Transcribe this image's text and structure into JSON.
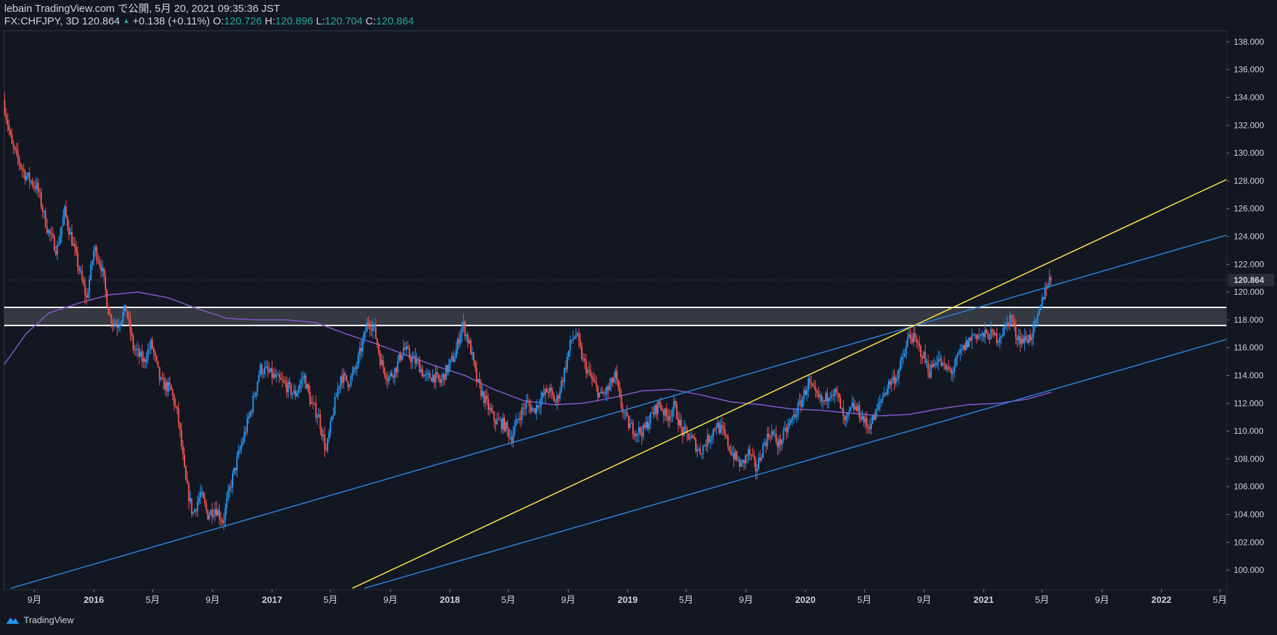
{
  "header": {
    "publish_line": "lebain TradingView.com で公開, 5月 20, 2021 09:35:36 JST",
    "symbol": "FX:CHFJPY, 3D",
    "last": "120.864",
    "change_arrow": "▲",
    "change": "+0.138 (+0.11%)",
    "o_label": "O:",
    "o_value": "120.726",
    "h_label": "H:",
    "h_value": "120.896",
    "l_label": "L:",
    "l_value": "120.704",
    "c_label": "C:",
    "c_value": "120.864"
  },
  "footer": {
    "brand": "TradingView",
    "logo_icon": "tradingview-logo-icon"
  },
  "colors": {
    "background": "#131722",
    "up": "#2196f3",
    "down": "#ef5350",
    "trendline_blue": "#2a7fd4",
    "trendline_yellow": "#f5e243",
    "ma": "#7e57c2",
    "zone_fill": "#3a3d45",
    "zone_border": "#ffffff",
    "price_label_bg": "#2a2e39"
  },
  "chart_data": {
    "type": "candlestick",
    "symbol": "FX:CHFJPY",
    "interval": "3D",
    "ylim": [
      98.6,
      138.8
    ],
    "xlim": [
      "2015-07-01",
      "2022-05-15"
    ],
    "y_ticks": [
      "100.000",
      "102.000",
      "104.000",
      "106.000",
      "108.000",
      "110.000",
      "112.000",
      "114.000",
      "116.000",
      "118.000",
      "120.000",
      "122.000",
      "124.000",
      "126.000",
      "128.000",
      "130.000",
      "132.000",
      "134.000",
      "136.000",
      "138.000"
    ],
    "x_ticks": [
      {
        "label": "9月",
        "date": "2015-09-01",
        "bold": false
      },
      {
        "label": "2016",
        "date": "2016-01-01",
        "bold": true
      },
      {
        "label": "5月",
        "date": "2016-05-01",
        "bold": false
      },
      {
        "label": "9月",
        "date": "2016-09-01",
        "bold": false
      },
      {
        "label": "2017",
        "date": "2017-01-01",
        "bold": true
      },
      {
        "label": "5月",
        "date": "2017-05-01",
        "bold": false
      },
      {
        "label": "9月",
        "date": "2017-09-01",
        "bold": false
      },
      {
        "label": "2018",
        "date": "2018-01-01",
        "bold": true
      },
      {
        "label": "5月",
        "date": "2018-05-01",
        "bold": false
      },
      {
        "label": "9月",
        "date": "2018-09-01",
        "bold": false
      },
      {
        "label": "2019",
        "date": "2019-01-01",
        "bold": true
      },
      {
        "label": "5月",
        "date": "2019-05-01",
        "bold": false
      },
      {
        "label": "9月",
        "date": "2019-09-01",
        "bold": false
      },
      {
        "label": "2020",
        "date": "2020-01-01",
        "bold": true
      },
      {
        "label": "5月",
        "date": "2020-05-01",
        "bold": false
      },
      {
        "label": "9月",
        "date": "2020-09-01",
        "bold": false
      },
      {
        "label": "2021",
        "date": "2021-01-01",
        "bold": true
      },
      {
        "label": "5月",
        "date": "2021-05-01",
        "bold": false
      },
      {
        "label": "9月",
        "date": "2021-09-01",
        "bold": false
      },
      {
        "label": "2022",
        "date": "2022-01-01",
        "bold": true
      },
      {
        "label": "5月",
        "date": "2022-05-01",
        "bold": false
      }
    ],
    "last_price": "120.864",
    "price_path": [
      [
        "2015-07-02",
        133.8
      ],
      [
        "2015-07-20",
        130.5
      ],
      [
        "2015-08-15",
        128.5
      ],
      [
        "2015-09-10",
        127.5
      ],
      [
        "2015-10-01",
        124.5
      ],
      [
        "2015-10-20",
        123.0
      ],
      [
        "2015-11-05",
        125.8
      ],
      [
        "2015-11-25",
        123.0
      ],
      [
        "2015-12-20",
        119.5
      ],
      [
        "2016-01-05",
        123.2
      ],
      [
        "2016-01-20",
        121.8
      ],
      [
        "2016-02-05",
        118.3
      ],
      [
        "2016-02-20",
        117.6
      ],
      [
        "2016-03-10",
        118.8
      ],
      [
        "2016-03-25",
        116.0
      ],
      [
        "2016-04-15",
        115.0
      ],
      [
        "2016-05-01",
        116.3
      ],
      [
        "2016-05-20",
        113.5
      ],
      [
        "2016-06-10",
        113.0
      ],
      [
        "2016-06-25",
        111.0
      ],
      [
        "2016-07-10",
        106.5
      ],
      [
        "2016-07-25",
        104.0
      ],
      [
        "2016-08-10",
        105.5
      ],
      [
        "2016-08-25",
        104.0
      ],
      [
        "2016-09-10",
        104.5
      ],
      [
        "2016-09-25",
        103.5
      ],
      [
        "2016-10-10",
        106.0
      ],
      [
        "2016-10-25",
        108.0
      ],
      [
        "2016-11-10",
        110.0
      ],
      [
        "2016-11-25",
        112.0
      ],
      [
        "2016-12-10",
        114.5
      ],
      [
        "2016-12-25",
        114.3
      ],
      [
        "2017-01-15",
        113.7
      ],
      [
        "2017-02-01",
        113.3
      ],
      [
        "2017-02-20",
        112.6
      ],
      [
        "2017-03-10",
        114.0
      ],
      [
        "2017-03-25",
        112.0
      ],
      [
        "2017-04-10",
        111.0
      ],
      [
        "2017-04-25",
        108.5
      ],
      [
        "2017-05-10",
        111.5
      ],
      [
        "2017-05-25",
        114.0
      ],
      [
        "2017-06-10",
        113.5
      ],
      [
        "2017-06-25",
        114.5
      ],
      [
        "2017-07-10",
        116.5
      ],
      [
        "2017-07-20",
        117.9
      ],
      [
        "2017-08-01",
        117.5
      ],
      [
        "2017-08-15",
        115.0
      ],
      [
        "2017-08-30",
        113.8
      ],
      [
        "2017-09-15",
        114.5
      ],
      [
        "2017-10-01",
        116.0
      ],
      [
        "2017-10-15",
        115.3
      ],
      [
        "2017-11-01",
        114.8
      ],
      [
        "2017-11-15",
        113.8
      ],
      [
        "2017-12-01",
        114.0
      ],
      [
        "2017-12-15",
        113.5
      ],
      [
        "2017-12-30",
        114.5
      ],
      [
        "2018-01-15",
        115.5
      ],
      [
        "2018-01-30",
        117.8
      ],
      [
        "2018-02-15",
        116.0
      ],
      [
        "2018-03-01",
        113.5
      ],
      [
        "2018-03-20",
        112.0
      ],
      [
        "2018-04-05",
        110.8
      ],
      [
        "2018-04-25",
        110.5
      ],
      [
        "2018-05-10",
        109.5
      ],
      [
        "2018-05-25",
        111.0
      ],
      [
        "2018-06-10",
        112.0
      ],
      [
        "2018-06-25",
        111.5
      ],
      [
        "2018-07-10",
        112.3
      ],
      [
        "2018-07-25",
        113.0
      ],
      [
        "2018-08-10",
        112.0
      ],
      [
        "2018-08-25",
        114.0
      ],
      [
        "2018-09-10",
        116.5
      ],
      [
        "2018-09-20",
        117.0
      ],
      [
        "2018-10-05",
        115.0
      ],
      [
        "2018-10-25",
        113.5
      ],
      [
        "2018-11-10",
        112.5
      ],
      [
        "2018-11-25",
        113.0
      ],
      [
        "2018-12-10",
        114.0
      ],
      [
        "2018-12-20",
        112.0
      ],
      [
        "2019-01-05",
        110.5
      ],
      [
        "2019-01-20",
        110.0
      ],
      [
        "2019-02-05",
        110.0
      ],
      [
        "2019-02-20",
        111.0
      ],
      [
        "2019-03-10",
        112.0
      ],
      [
        "2019-03-25",
        111.0
      ],
      [
        "2019-04-10",
        111.8
      ],
      [
        "2019-04-25",
        110.0
      ],
      [
        "2019-05-15",
        109.5
      ],
      [
        "2019-06-01",
        108.5
      ],
      [
        "2019-06-20",
        109.5
      ],
      [
        "2019-07-05",
        110.5
      ],
      [
        "2019-07-20",
        109.8
      ],
      [
        "2019-08-05",
        108.5
      ],
      [
        "2019-08-25",
        107.5
      ],
      [
        "2019-09-10",
        108.5
      ],
      [
        "2019-09-25",
        107.2
      ],
      [
        "2019-10-10",
        109.0
      ],
      [
        "2019-10-25",
        110.0
      ],
      [
        "2019-11-10",
        109.0
      ],
      [
        "2019-11-25",
        110.0
      ],
      [
        "2019-12-10",
        111.0
      ],
      [
        "2019-12-25",
        112.0
      ],
      [
        "2020-01-10",
        113.5
      ],
      [
        "2020-01-25",
        112.5
      ],
      [
        "2020-02-10",
        112.0
      ],
      [
        "2020-02-25",
        113.0
      ],
      [
        "2020-03-10",
        112.5
      ],
      [
        "2020-03-25",
        110.5
      ],
      [
        "2020-04-10",
        111.8
      ],
      [
        "2020-04-25",
        111.3
      ],
      [
        "2020-05-10",
        110.3
      ],
      [
        "2020-05-25",
        111.0
      ],
      [
        "2020-06-10",
        112.5
      ],
      [
        "2020-06-25",
        113.5
      ],
      [
        "2020-07-10",
        114.0
      ],
      [
        "2020-07-25",
        115.5
      ],
      [
        "2020-08-05",
        117.0
      ],
      [
        "2020-08-15",
        116.5
      ],
      [
        "2020-09-01",
        115.5
      ],
      [
        "2020-09-15",
        114.3
      ],
      [
        "2020-10-01",
        115.3
      ],
      [
        "2020-10-15",
        114.5
      ],
      [
        "2020-11-01",
        114.3
      ],
      [
        "2020-11-15",
        115.5
      ],
      [
        "2020-12-01",
        116.3
      ],
      [
        "2020-12-15",
        117.0
      ],
      [
        "2021-01-01",
        116.8
      ],
      [
        "2021-01-15",
        117.0
      ],
      [
        "2021-02-01",
        116.7
      ],
      [
        "2021-02-15",
        117.3
      ],
      [
        "2021-03-01",
        118.3
      ],
      [
        "2021-03-10",
        117.0
      ],
      [
        "2021-03-25",
        116.5
      ],
      [
        "2021-04-10",
        116.8
      ],
      [
        "2021-04-25",
        118.0
      ],
      [
        "2021-05-05",
        119.5
      ],
      [
        "2021-05-12",
        120.5
      ],
      [
        "2021-05-19",
        120.86
      ]
    ],
    "moving_average": [
      [
        "2015-07-01",
        114.8
      ],
      [
        "2015-08-15",
        117.0
      ],
      [
        "2015-10-01",
        118.5
      ],
      [
        "2015-12-01",
        119.2
      ],
      [
        "2016-02-01",
        119.8
      ],
      [
        "2016-04-01",
        120.0
      ],
      [
        "2016-06-01",
        119.6
      ],
      [
        "2016-08-01",
        118.8
      ],
      [
        "2016-10-01",
        118.1
      ],
      [
        "2016-12-01",
        118.0
      ],
      [
        "2017-02-01",
        118.0
      ],
      [
        "2017-04-01",
        117.8
      ],
      [
        "2017-06-01",
        117.0
      ],
      [
        "2017-08-01",
        116.3
      ],
      [
        "2017-10-01",
        115.5
      ],
      [
        "2017-12-01",
        114.7
      ],
      [
        "2018-02-01",
        114.0
      ],
      [
        "2018-04-01",
        113.0
      ],
      [
        "2018-06-01",
        112.2
      ],
      [
        "2018-08-01",
        111.9
      ],
      [
        "2018-10-01",
        112.0
      ],
      [
        "2018-12-01",
        112.4
      ],
      [
        "2019-02-01",
        112.9
      ],
      [
        "2019-04-01",
        113.0
      ],
      [
        "2019-06-01",
        112.6
      ],
      [
        "2019-08-01",
        112.1
      ],
      [
        "2019-10-01",
        111.9
      ],
      [
        "2019-12-01",
        111.6
      ],
      [
        "2020-02-01",
        111.5
      ],
      [
        "2020-04-01",
        111.3
      ],
      [
        "2020-06-01",
        111.1
      ],
      [
        "2020-08-01",
        111.2
      ],
      [
        "2020-10-01",
        111.6
      ],
      [
        "2020-12-01",
        111.9
      ],
      [
        "2021-02-01",
        112.0
      ],
      [
        "2021-04-01",
        112.3
      ],
      [
        "2021-05-20",
        112.8
      ]
    ],
    "trendlines": [
      {
        "color": "blue",
        "from": [
          "2015-07-15",
          98.7
        ],
        "to": [
          "2022-05-15",
          124.1
        ]
      },
      {
        "color": "blue",
        "from": [
          "2017-07-10",
          98.7
        ],
        "to": [
          "2022-05-15",
          116.6
        ]
      },
      {
        "color": "yellow",
        "from": [
          "2017-06-15",
          98.7
        ],
        "to": [
          "2022-05-15",
          128.1
        ]
      }
    ],
    "zone": {
      "top": 118.9,
      "bottom": 117.6
    }
  }
}
